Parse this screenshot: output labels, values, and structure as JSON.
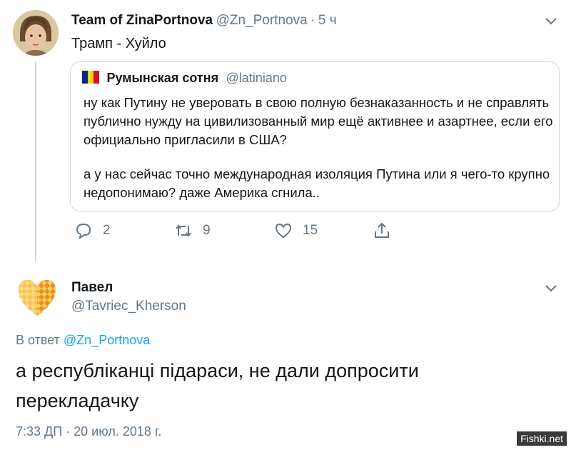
{
  "tweet1": {
    "author_name": "Team of ZinaPortnova",
    "author_handle": "@Zn_Portnova",
    "separator": "·",
    "time_ago": "5 ч",
    "text": "Трамп - Хуйло",
    "quote": {
      "flag_colors": [
        "#002b7f",
        "#fcd116",
        "#ce1126"
      ],
      "author_name": "Румынская сотня",
      "author_handle": "@latiniano",
      "paragraph1": "ну как Путину не уверовать в свою полную безнаказанность и не справлять публично нужду на цивилизованный мир ещё активнее и азартнее, если его официально пригласили в США?",
      "paragraph2": "а у нас сейчас точно международная изоляция Путина или я чего-то крупно недопонимаю? даже Америка сгнила.."
    },
    "actions": {
      "reply_icon": "reply-icon",
      "reply_count": "2",
      "retweet_icon": "retweet-icon",
      "retweet_count": "9",
      "like_icon": "heart-icon",
      "like_count": "15",
      "share_icon": "share-icon"
    }
  },
  "tweet2": {
    "author_name": "Павел",
    "author_handle": "@Tavriec_Kherson",
    "reply_prefix": "В ответ",
    "reply_handle": "@Zn_Portnova",
    "text": "а республіканці підараси, не дали допросити перекладачку",
    "timestamp": "7:33 ДП · 20 июл. 2018 г."
  },
  "watermark": "Fishki.net",
  "colors": {
    "link": "#1da1f2",
    "muted": "#657786",
    "border": "#ccd6dd"
  }
}
